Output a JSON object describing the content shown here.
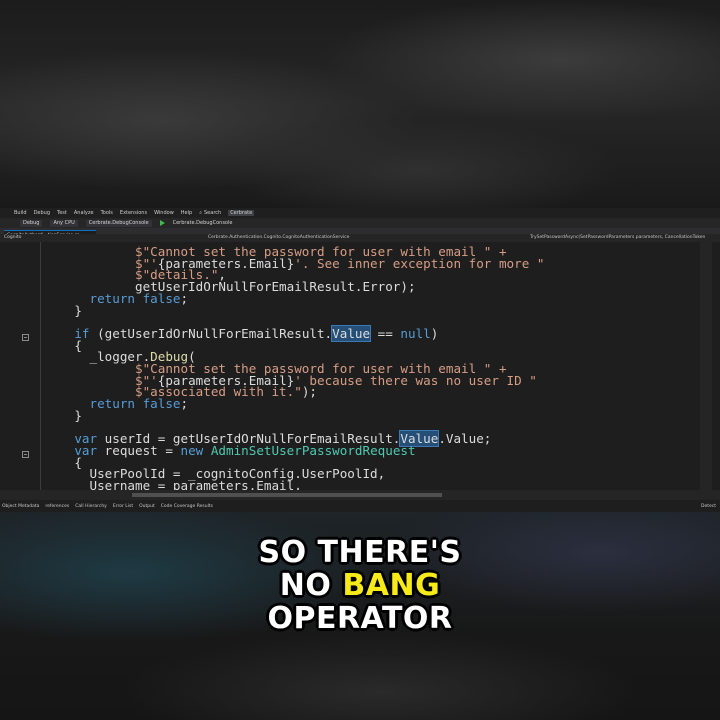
{
  "menu": {
    "items": [
      "Build",
      "Debug",
      "Test",
      "Analyze",
      "Tools",
      "Extensions",
      "Window",
      "Help"
    ],
    "search_label": "Search",
    "active_item": "Cerbrate"
  },
  "toolbar": {
    "config": "Debug",
    "platform": "Any CPU",
    "startup_project": "Cerbrate.DebugConsole",
    "run_target": "Cerbrate.DebugConsole"
  },
  "tab": {
    "title": "CognitoAuthenti...tionService.cs"
  },
  "nav": {
    "left": "Cognito",
    "middle": "Cerbrate.Authentication.Cognito.CognitoAuthenticationService",
    "right": "TrySetPasswordAsync(SetPasswordParameters parameters, CancellationToken"
  },
  "code_lines": [
    {
      "parts": [
        {
          "t": "            "
        },
        {
          "t": "$\"Cannot set the password for user with email \" +",
          "c": "str"
        }
      ]
    },
    {
      "parts": [
        {
          "t": "            "
        },
        {
          "t": "$\"'",
          "c": "str"
        },
        {
          "t": "{parameters.Email}"
        },
        {
          "t": "'. See inner exception for more \"",
          "c": "str"
        }
      ]
    },
    {
      "parts": [
        {
          "t": "            "
        },
        {
          "t": "$\"details.\"",
          "c": "str"
        },
        {
          "t": ","
        }
      ]
    },
    {
      "parts": [
        {
          "t": "            getUserIdOrNullForEmailResult.Error);"
        }
      ]
    },
    {
      "parts": [
        {
          "t": "      "
        },
        {
          "t": "return",
          "c": "kw"
        },
        {
          "t": " "
        },
        {
          "t": "false",
          "c": "kw"
        },
        {
          "t": ";"
        }
      ]
    },
    {
      "parts": [
        {
          "t": "    }"
        }
      ]
    },
    {
      "parts": [
        {
          "t": ""
        }
      ]
    },
    {
      "parts": [
        {
          "t": "    "
        },
        {
          "t": "if",
          "c": "kw"
        },
        {
          "t": " (getUserIdOrNullForEmailResult."
        },
        {
          "t": "Value",
          "c": "hl"
        },
        {
          "t": " == "
        },
        {
          "t": "null",
          "c": "kw"
        },
        {
          "t": ")"
        }
      ]
    },
    {
      "parts": [
        {
          "t": "    {"
        }
      ]
    },
    {
      "parts": [
        {
          "t": "      _logger."
        },
        {
          "t": "Debug",
          "c": "meth"
        },
        {
          "t": "("
        }
      ]
    },
    {
      "parts": [
        {
          "t": "            "
        },
        {
          "t": "$\"Cannot set the password for user with email \" +",
          "c": "str"
        }
      ]
    },
    {
      "parts": [
        {
          "t": "            "
        },
        {
          "t": "$\"'",
          "c": "str"
        },
        {
          "t": "{parameters.Email}"
        },
        {
          "t": "' because there was no user ID \"",
          "c": "str"
        }
      ]
    },
    {
      "parts": [
        {
          "t": "            "
        },
        {
          "t": "$\"associated with it.\"",
          "c": "str"
        },
        {
          "t": ");"
        }
      ]
    },
    {
      "parts": [
        {
          "t": "      "
        },
        {
          "t": "return",
          "c": "kw"
        },
        {
          "t": " "
        },
        {
          "t": "false",
          "c": "kw"
        },
        {
          "t": ";"
        }
      ]
    },
    {
      "parts": [
        {
          "t": "    }"
        }
      ]
    },
    {
      "parts": [
        {
          "t": ""
        }
      ]
    },
    {
      "parts": [
        {
          "t": "    "
        },
        {
          "t": "var",
          "c": "kw"
        },
        {
          "t": " userId = getUserIdOrNullForEmailResult."
        },
        {
          "t": "Value",
          "c": "hl"
        },
        {
          "t": ".Value;"
        }
      ]
    },
    {
      "parts": [
        {
          "t": "    "
        },
        {
          "t": "var",
          "c": "kw"
        },
        {
          "t": " request = "
        },
        {
          "t": "new",
          "c": "kw"
        },
        {
          "t": " "
        },
        {
          "t": "AdminSetUserPasswordRequest",
          "c": "type"
        }
      ]
    },
    {
      "parts": [
        {
          "t": "    {"
        }
      ]
    },
    {
      "parts": [
        {
          "t": "      UserPoolId = _cognitoConfig.UserPoolId,"
        }
      ]
    },
    {
      "parts": [
        {
          "t": "      Username = parameters.Email,"
        }
      ]
    }
  ],
  "status": {
    "zoom": "",
    "tool_tabs": [
      "Object Metadata",
      "references",
      "Call Hierarchy",
      "Error List",
      "Output",
      "Code Coverage Results"
    ],
    "right_label": "Detect"
  },
  "caption": {
    "line1": "SO THERE'S",
    "line2_white": "NO",
    "line2_yellow": "BANG",
    "line3": "OPERATOR"
  },
  "colors": {
    "caption_accent": "#f7ea18",
    "keyword": "#569cd6",
    "string": "#d69d85",
    "type": "#4ec9b0",
    "method": "#dcdcaa"
  }
}
